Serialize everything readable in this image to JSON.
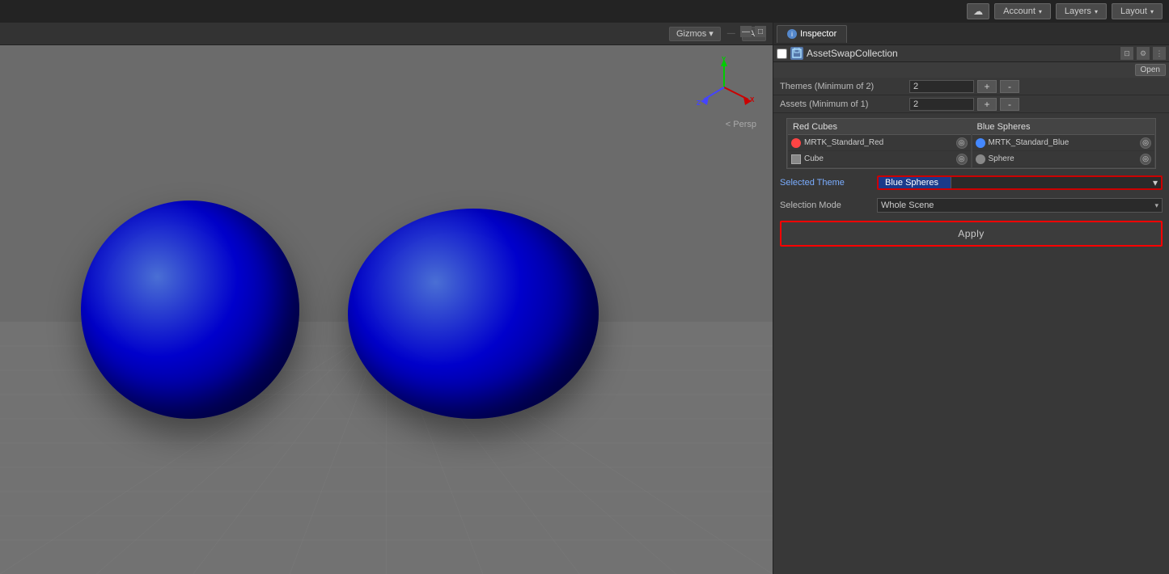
{
  "topbar": {
    "cloud_icon": "☁",
    "account_label": "Account",
    "layers_label": "Layers",
    "layout_label": "Layout"
  },
  "viewport": {
    "gizmos_label": "Gizmos",
    "all_label": "All",
    "persp_label": "< Persp"
  },
  "inspector": {
    "tab_label": "Inspector",
    "tab_icon": "i",
    "obj_icon": "▣",
    "obj_title": "AssetSwapCollection",
    "open_label": "Open",
    "themes_label": "Themes (Minimum of 2)",
    "themes_value": "2",
    "assets_label": "Assets (Minimum of 1)",
    "assets_value": "2",
    "plus_label": "+",
    "minus_label": "-",
    "theme_cols": [
      {
        "header": "Red Cubes",
        "assets": [
          {
            "icon": "red",
            "name": "MRTK_Standard_Red"
          },
          {
            "icon": "cube",
            "name": "Cube"
          }
        ]
      },
      {
        "header": "Blue Spheres",
        "assets": [
          {
            "icon": "blue",
            "name": "MRTK_Standard_Blue"
          },
          {
            "icon": "sphere",
            "name": "Sphere"
          }
        ]
      }
    ],
    "selected_theme_label": "Selected Theme",
    "selected_theme_value": "Blue Spheres",
    "selection_mode_label": "Selection Mode",
    "selection_mode_value": "Whole Scene",
    "apply_label": "Apply"
  }
}
